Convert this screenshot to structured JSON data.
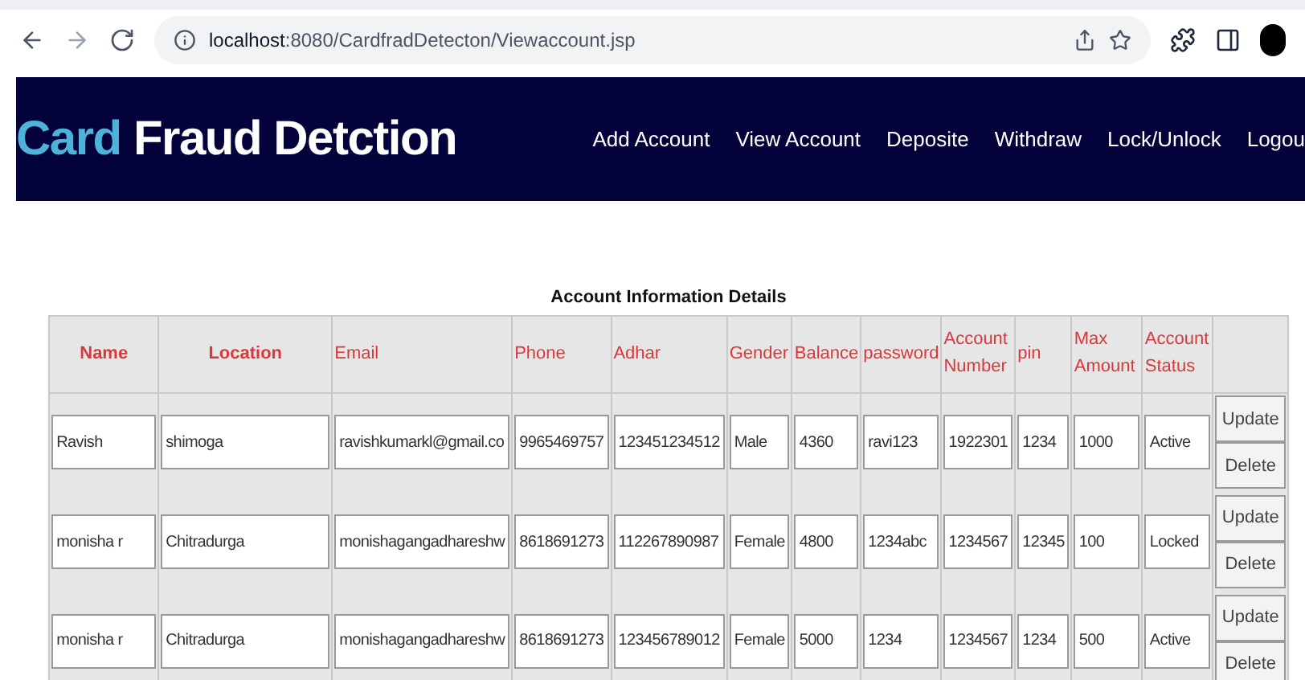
{
  "browser": {
    "url_host": "localhost",
    "url_path": ":8080/CardfradDetecton/Viewaccount.jsp"
  },
  "brand": {
    "accent": "Card",
    "rest": "Fraud Detction"
  },
  "nav": [
    "Add Account",
    "View Account",
    "Deposite",
    "Withdraw",
    "Lock/Unlock",
    "Logou"
  ],
  "table": {
    "title": "Account Information Details",
    "columns": [
      {
        "label": "Name",
        "bold": true
      },
      {
        "label": "Location",
        "bold": true
      },
      {
        "label": "Email",
        "bold": false
      },
      {
        "label": "Phone",
        "bold": false
      },
      {
        "label": "Adhar",
        "bold": false
      },
      {
        "label": "Gender",
        "bold": false
      },
      {
        "label": "Balance",
        "bold": false
      },
      {
        "label": "password",
        "bold": false
      },
      {
        "label": "Account Number",
        "bold": false
      },
      {
        "label": "pin",
        "bold": false
      },
      {
        "label": "Max Amount",
        "bold": false
      },
      {
        "label": "Account Status",
        "bold": false
      }
    ],
    "rows": [
      {
        "cells": [
          "Ravish",
          "shimoga",
          "ravishkumarkl@gmail.co",
          "9965469757",
          "123451234512",
          "Male",
          "4360",
          "ravi123",
          "1922301",
          "1234",
          "1000",
          "Active"
        ],
        "actions": [
          "Update",
          "Delete"
        ]
      },
      {
        "cells": [
          "monisha r",
          "Chitradurga",
          "monishagangadhareshw",
          "8618691273",
          "112267890987",
          "Female",
          "4800",
          "1234abc",
          "1234567",
          "12345",
          "100",
          "Locked"
        ],
        "actions": [
          "Update",
          "Delete"
        ]
      },
      {
        "cells": [
          "monisha r",
          "Chitradurga",
          "monishagangadhareshw",
          "8618691273",
          "123456789012",
          "Female",
          "5000",
          "1234",
          "1234567",
          "1234",
          "500",
          "Active"
        ],
        "actions": [
          "Update",
          "Delete"
        ]
      }
    ]
  }
}
